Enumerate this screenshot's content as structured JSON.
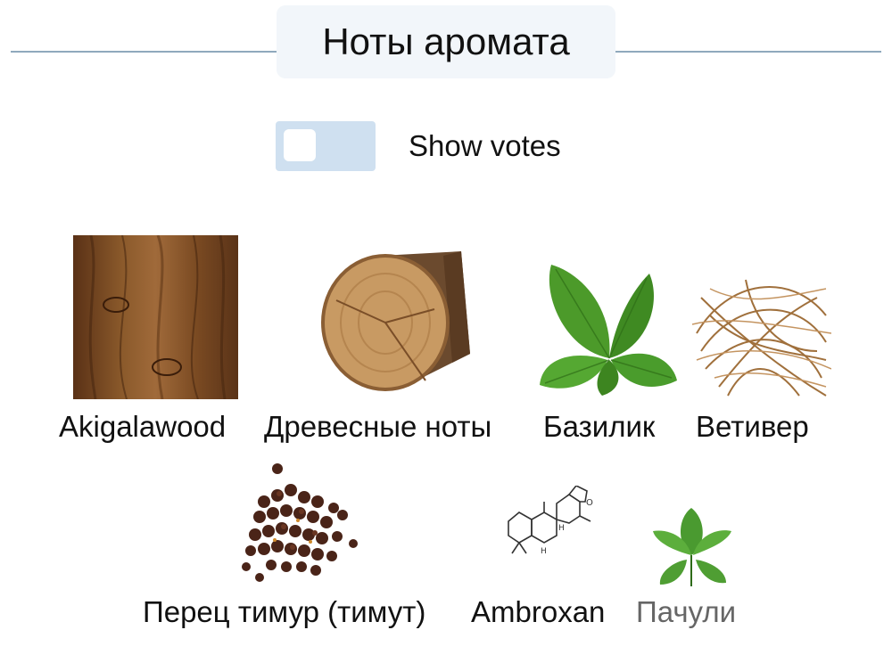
{
  "header": {
    "title": "Ноты аромата"
  },
  "toggle": {
    "label": "Show votes",
    "checked": false
  },
  "notes": [
    {
      "label": "Akigalawood",
      "icon": "wood-plank-icon"
    },
    {
      "label": "Древесные ноты",
      "icon": "wood-log-icon"
    },
    {
      "label": "Базилик",
      "icon": "basil-leaves-icon"
    },
    {
      "label": "Ветивер",
      "icon": "vetiver-roots-icon"
    },
    {
      "label": "Перец тимур (тимут)",
      "icon": "peppercorns-icon"
    },
    {
      "label": "Ambroxan",
      "icon": "ambroxan-molecule-icon"
    },
    {
      "label": "Пачули",
      "icon": "patchouli-leaves-icon"
    }
  ]
}
